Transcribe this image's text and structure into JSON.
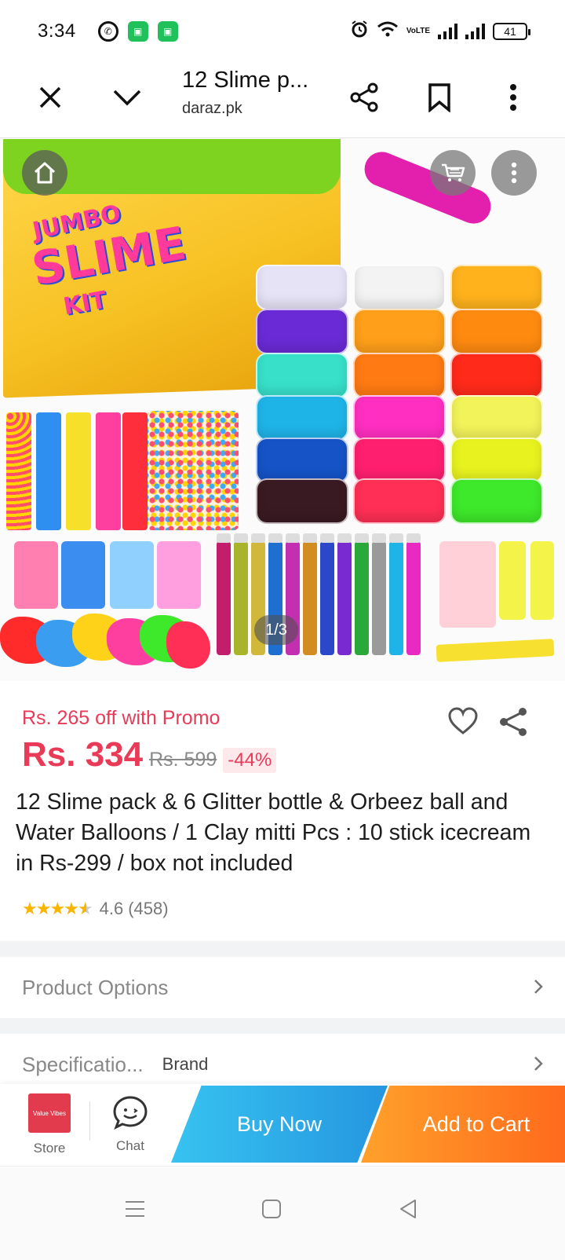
{
  "status_bar": {
    "time": "3:34",
    "battery": "41",
    "network": "VoLTE"
  },
  "browser": {
    "title": "12 Slime p...",
    "domain": "daraz.pk"
  },
  "gallery": {
    "counter": "1/3",
    "box_text": [
      "JUMBO",
      "SLIME",
      "KIT"
    ]
  },
  "product": {
    "promo": "Rs. 265 off with Promo",
    "price": "Rs. 334",
    "old_price": "Rs. 599",
    "discount": "-44%",
    "title": "12 Slime pack & 6 Glitter bottle & Orbeez ball and Water Balloons / 1 Clay mitti Pcs : 10 stick icecream in Rs-299 / box not included",
    "rating": "4.6",
    "rating_count": "(458)",
    "stars_value": 4.6
  },
  "sections": {
    "options_label": "Product Options",
    "spec_label": "Specificatio...",
    "spec_value": "Brand"
  },
  "actions": {
    "store_label": "Store",
    "store_logo_text": "Value Vibes",
    "chat_label": "Chat",
    "buy_now": "Buy Now",
    "add_to_cart": "Add to Cart"
  },
  "colors": {
    "price_red": "#e93a57",
    "buy_now_blue": "#2596e0",
    "add_cart_orange": "#ff6a1c"
  }
}
